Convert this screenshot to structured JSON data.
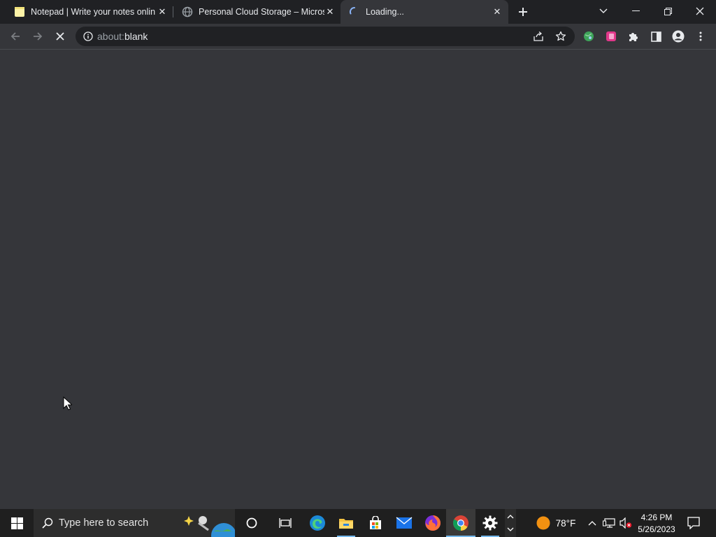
{
  "browser": {
    "tabs": [
      {
        "title": "Notepad | Write your notes onlin",
        "favicon": "notepad-icon"
      },
      {
        "title": "Personal Cloud Storage – Microso",
        "favicon": "globe-icon"
      },
      {
        "title": "Loading...",
        "favicon": "spinner-icon",
        "active": true
      }
    ],
    "address": {
      "prefix": "about:",
      "rest": "blank"
    },
    "colors": {
      "frame": "#202124",
      "toolbar": "#35363a",
      "omnibox": "#202124",
      "text": "#e8eaed"
    }
  },
  "taskbar": {
    "search_placeholder": "Type here to search",
    "weather": "78°F",
    "time": "4:26 PM",
    "date": "5/26/2023",
    "colors": {
      "bar": "#1f1f1f",
      "search": "#2d2d2d",
      "accent": "#76b9ed"
    }
  }
}
